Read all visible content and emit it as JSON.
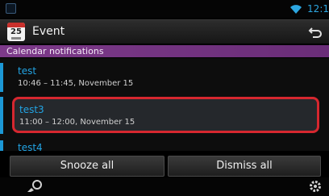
{
  "status_bar": {
    "clock": "12:1",
    "icons": [
      "app-icon",
      "wifi-icon"
    ]
  },
  "title_bar": {
    "calendar_icon_number": "25",
    "title": "Event",
    "back_icon": "back-arrow-icon"
  },
  "section_header": {
    "label": "Calendar notifications"
  },
  "notifications": [
    {
      "title": "test",
      "time": "10:46 – 11:45, November 15",
      "selected": false
    },
    {
      "title": "test3",
      "time": "11:00 – 12:00, November 15",
      "selected": true
    },
    {
      "title": "test4",
      "time": "",
      "selected": false
    }
  ],
  "buttons": {
    "snooze_all": "Snooze all",
    "dismiss_all": "Dismiss all"
  },
  "bottom_bar": {
    "icons": [
      "hands-free-icon",
      "gear-icon"
    ]
  },
  "colors": {
    "accent_blue": "#22a4e4",
    "section_purple": "#7d3a8a",
    "highlight_red": "#d6272f"
  }
}
